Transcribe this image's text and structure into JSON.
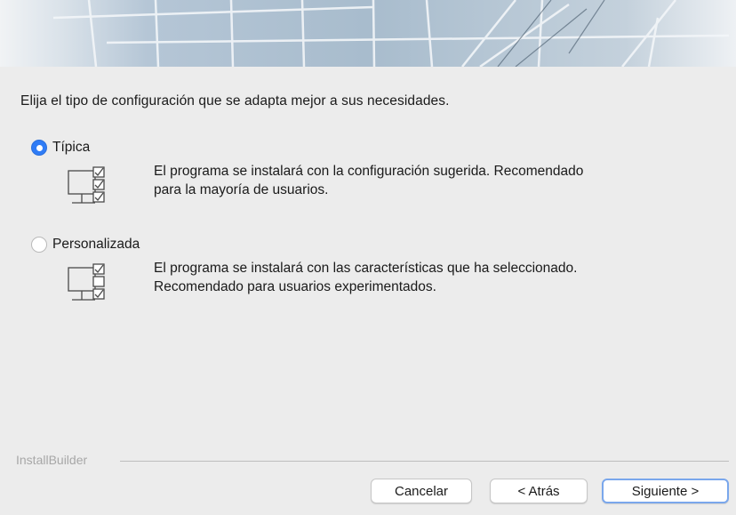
{
  "window": {
    "instruction": "Elija el tipo de configuración que se adapta mejor a sus necesidades."
  },
  "options": [
    {
      "label": "Típica",
      "selected": true,
      "icon": "monitor-all-checked-icon",
      "description_line1": "El programa se instalará con la configuración sugerida. Recomendado",
      "description_line2": "para la mayoría de usuarios."
    },
    {
      "label": "Personalizada",
      "selected": false,
      "icon": "monitor-partial-checked-icon",
      "description_line1": "El programa se instalará con las características que ha seleccionado.",
      "description_line2": "Recomendado para usuarios experimentados."
    }
  ],
  "footer": {
    "brand": "InstallBuilder"
  },
  "buttons": {
    "cancel": "Cancelar",
    "back": "< Atrás",
    "next": "Siguiente >"
  },
  "colors": {
    "accent": "#2f7cf6",
    "background": "#ececec",
    "banner": "#b9cad8"
  }
}
